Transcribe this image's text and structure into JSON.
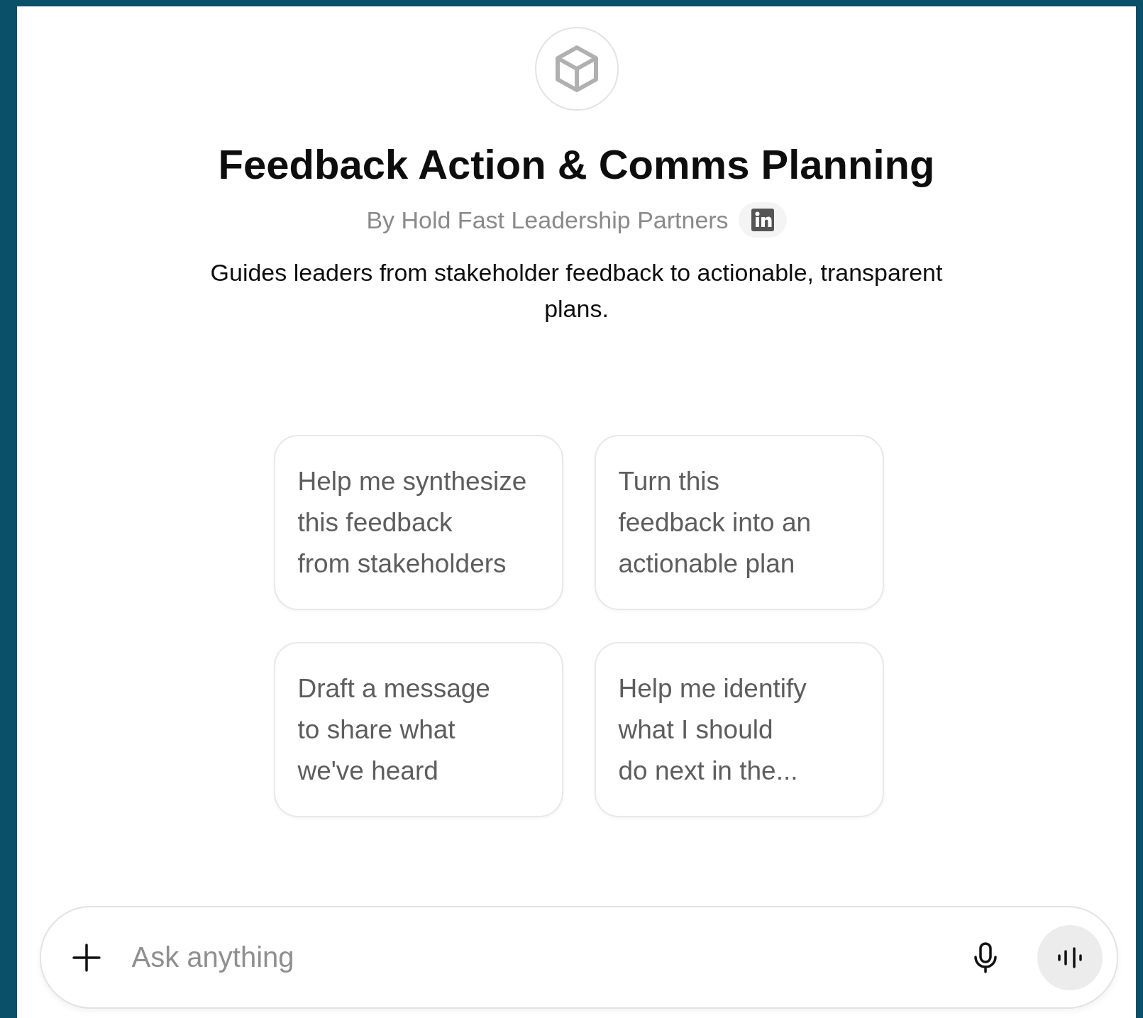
{
  "title": "Feedback Action & Comms Planning",
  "author": "By Hold Fast Leadership Partners",
  "description": "Guides leaders from stakeholder feedback to actionable, transparent plans.",
  "suggestions": [
    {
      "lines": [
        "Help me synthesize",
        "this feedback",
        "from stakeholders"
      ]
    },
    {
      "lines": [
        "Turn this",
        "feedback into an",
        "actionable plan"
      ]
    },
    {
      "lines": [
        "Draft a message",
        "to share what",
        "we've heard"
      ]
    },
    {
      "lines": [
        "Help me identify",
        "what I should",
        "do next in the..."
      ]
    }
  ],
  "composer": {
    "placeholder": "Ask anything"
  }
}
